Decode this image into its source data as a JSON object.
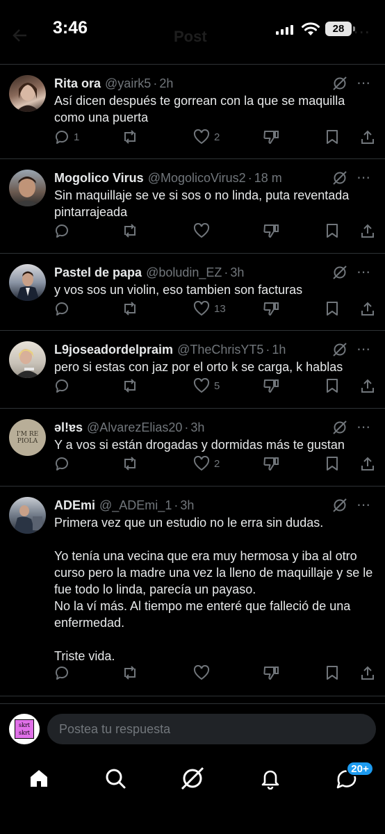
{
  "status_bar": {
    "time": "3:46",
    "battery": "28"
  },
  "header": {
    "title": "Post"
  },
  "replies": [
    {
      "name": "Rita ora",
      "handle": "@yairk5",
      "time": "2h",
      "text": "Así dicen después te gorrean con la que se maquilla como una puerta",
      "stats": {
        "replies": "1",
        "reposts": "",
        "likes": "2"
      },
      "avatar_color": "#8a6a5a"
    },
    {
      "name": "Mogolico Virus",
      "handle": "@MogolicoVirus2",
      "time": "18 m",
      "text": "Sin maquillaje se ve si sos o no linda, puta reventada pintarrajeada",
      "stats": {
        "replies": "",
        "reposts": "",
        "likes": ""
      },
      "avatar_color": "#6b5a50"
    },
    {
      "name": "Pastel de papa",
      "handle": "@boludin_EZ",
      "time": "3h",
      "text": "y vos sos un violin, eso tambien son facturas",
      "stats": {
        "replies": "",
        "reposts": "",
        "likes": "13"
      },
      "avatar_color": "#3a4050"
    },
    {
      "name": "L9joseadordelpraim",
      "handle": "@TheChrisYT5",
      "time": "1h",
      "text": "pero si estas con jaz por el orto k se carga, k hablas",
      "stats": {
        "replies": "",
        "reposts": "",
        "likes": "5"
      },
      "avatar_color": "#c8c2b8"
    },
    {
      "name": "əl!ɐs",
      "handle": "@AlvarezElias20",
      "time": "3h",
      "text": "Y a vos si están drogadas y dormidas más te gustan",
      "stats": {
        "replies": "",
        "reposts": "",
        "likes": "2"
      },
      "avatar_color": "#b8ae98",
      "avatar_text": "I'M RE PIOLA"
    },
    {
      "name": "ADEmi",
      "handle": "@_ADEmi_1",
      "time": "3h",
      "text": "Primera vez que un estudio no le erra sin dudas.\n\nYo tenía una vecina que era muy hermosa y iba al otro curso pero la madre una vez la lleno de maquillaje y se le fue todo lo linda, parecía un payaso.\nNo la ví más. Al tiempo me enteré que falleció de una enfermedad.\n\nTriste vida.",
      "stats": {
        "replies": "",
        "reposts": "",
        "likes": ""
      },
      "avatar_color": "#707a88"
    }
  ],
  "compose": {
    "placeholder": "Postea tu respuesta",
    "avatar_text": "skrt skrt"
  },
  "nav": {
    "notification_badge": "20+"
  },
  "colors": {
    "background": "#000000",
    "text": "#e7e9ea",
    "muted": "#71767b",
    "accent": "#1d9bf0",
    "divider": "#2f3336"
  }
}
